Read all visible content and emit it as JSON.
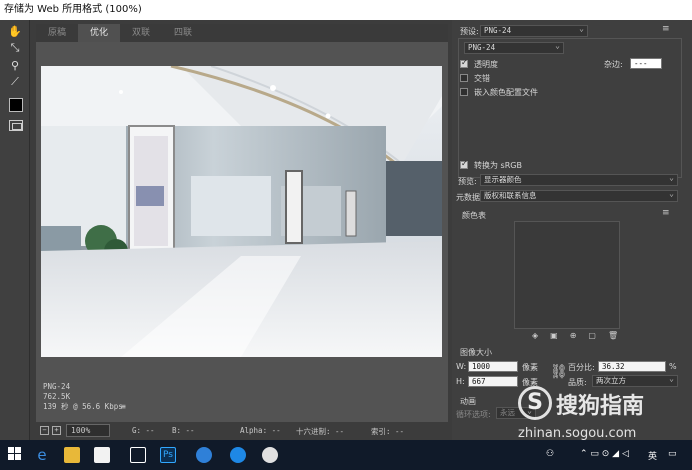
{
  "window": {
    "title": "存储为 Web 所用格式 (100%)"
  },
  "tabs": [
    {
      "label": "原稿"
    },
    {
      "label": "优化"
    },
    {
      "label": "双联"
    },
    {
      "label": "四联"
    }
  ],
  "image_info": {
    "format": "PNG-24",
    "size": "762.5K",
    "time": "139 秒 @ 56.6 Kbps",
    "menu_icon": "≡"
  },
  "statusbar": {
    "zoom": "100%",
    "g": "G: --",
    "b": "B: --",
    "alpha": "Alpha: --",
    "hex": "十六进制: --",
    "index": "索引: --"
  },
  "right_panel": {
    "preset_label": "预设:",
    "preset_value": "PNG-24",
    "format_value": "PNG-24",
    "transparency": "透明度",
    "transparency_checked": true,
    "matte_label": "杂边:",
    "matte_value": "---",
    "interlaced": "交错",
    "interlaced_checked": false,
    "embed_profile": "嵌入颜色配置文件",
    "embed_checked": false,
    "convert_srgb": "转换为 sRGB",
    "convert_checked": true,
    "preview_label": "预览:",
    "preview_value": "显示器颜色",
    "metadata_label": "元数据:",
    "metadata_value": "版权和联系信息",
    "color_table_label": "颜色表",
    "image_size_label": "图像大小",
    "w_label": "W:",
    "w_value": "1000",
    "h_label": "H:",
    "h_value": "667",
    "px_unit_w": "像素",
    "px_unit_h": "像素",
    "percent_label": "百分比:",
    "percent_value": "36.32",
    "percent_unit": "%",
    "quality_label": "品质:",
    "quality_value": "两次立方",
    "animation_label": "动画",
    "loop_label": "循环选项:",
    "loop_value": "永远"
  },
  "taskbar": {
    "ime": "英",
    "ps_label": "Ps"
  },
  "watermark": {
    "main": "搜狗指南",
    "sub": "zhinan.sogou.com"
  },
  "colors": {
    "accent_ps": "#0b2f52",
    "taskbar_bg": "#101a29"
  }
}
